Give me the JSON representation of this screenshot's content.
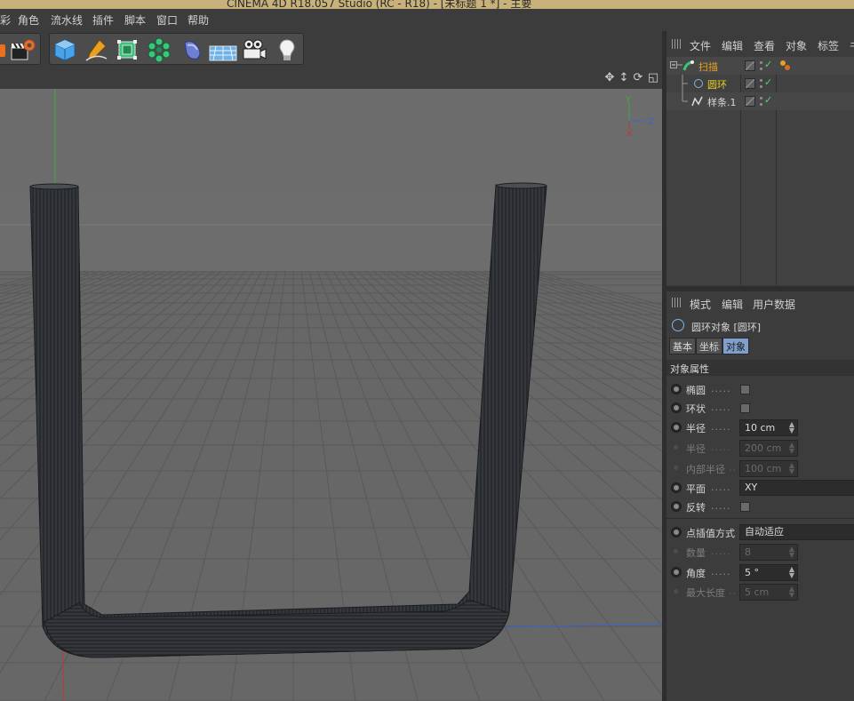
{
  "titlebar": {
    "title": "CINEMA 4D R18.057 Studio (RC - R18) - [未标题 1 *] - 主要"
  },
  "menu": {
    "items": [
      "彩",
      "角色",
      "流水线",
      "插件",
      "脚本",
      "窗口",
      "帮助"
    ]
  },
  "toolbar": {
    "icons": [
      "render-settings-icon",
      "clapper-icon",
      "cube-icon",
      "pen-icon",
      "subdivision-icon",
      "array-icon",
      "deformer-icon",
      "floor-icon",
      "camera-icon",
      "light-icon"
    ]
  },
  "viewport": {
    "axis": {
      "y": "Y",
      "z": "Z",
      "x": "X"
    },
    "colors": {
      "bg": "#6f6f6f",
      "grid": "#5a5a5a",
      "tube": "#2e3236",
      "y_axis": "#3fae3f",
      "x_axis": "#c0392b",
      "z_axis": "#3a63d6"
    }
  },
  "objects_panel": {
    "menu": [
      "文件",
      "编辑",
      "查看",
      "对象",
      "标签",
      "书"
    ],
    "rows": [
      {
        "name": "扫描",
        "color": "#e8a021"
      },
      {
        "name": "圆环",
        "color": "#e8d021"
      },
      {
        "name": "样条.1",
        "color": "#d8d8d8"
      }
    ]
  },
  "attributes_panel": {
    "menu": [
      "模式",
      "编辑",
      "用户数据"
    ],
    "title": "圆环对象 [圆环]",
    "tabs": [
      "基本",
      "坐标",
      "对象"
    ],
    "active_tab": "对象",
    "section": "对象属性",
    "props": {
      "ellipse": {
        "label": "椭圆"
      },
      "ring": {
        "label": "环状"
      },
      "radius": {
        "label": "半径",
        "value": "10 cm"
      },
      "radius2": {
        "label": "半径",
        "value": "200 cm"
      },
      "inner_radius": {
        "label": "内部半径",
        "value": "100 cm"
      },
      "plane": {
        "label": "平面",
        "value": "XY"
      },
      "reverse": {
        "label": "反转"
      },
      "interpolation": {
        "label": "点插值方式",
        "value": "自动适应"
      },
      "count": {
        "label": "数量",
        "value": "8"
      },
      "angle": {
        "label": "角度",
        "value": "5 °"
      },
      "max_length": {
        "label": "最大长度",
        "value": "5 cm"
      }
    }
  }
}
